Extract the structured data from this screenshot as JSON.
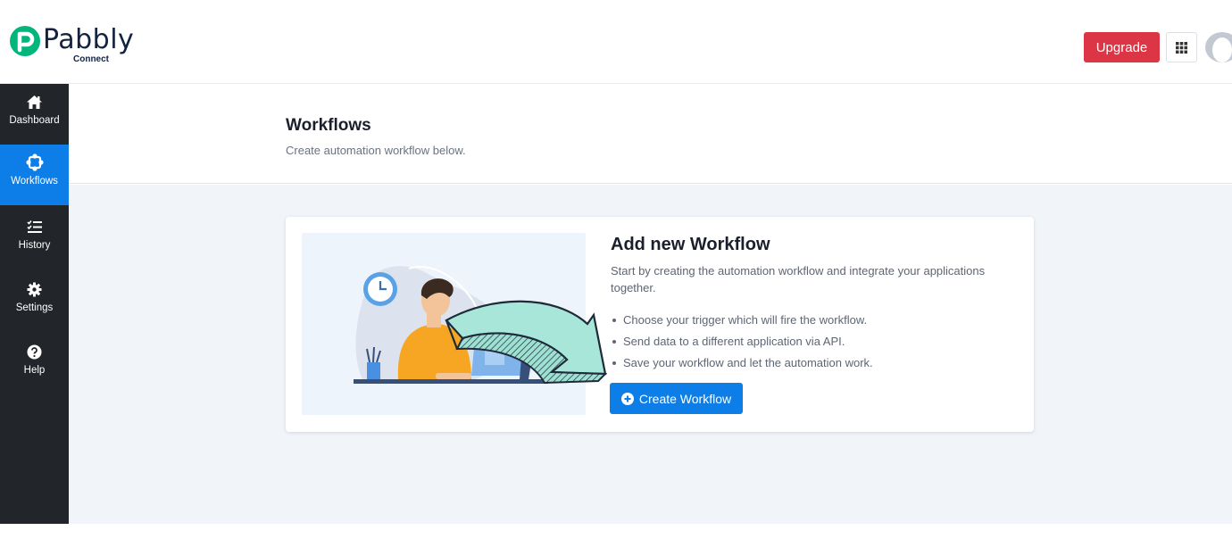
{
  "brand": {
    "name": "Pabbly",
    "product": "Connect",
    "color": "#13233f",
    "accent": "#00b67a"
  },
  "header": {
    "upgrade_label": "Upgrade",
    "upgrade_color": "#dc3545",
    "apps_icon": "grid-icon",
    "avatar_icon": "user-avatar-icon"
  },
  "sidebar": {
    "items": [
      {
        "label": "Dashboard",
        "icon": "home-icon",
        "active": false
      },
      {
        "label": "Workflows",
        "icon": "workflow-icon",
        "active": true
      },
      {
        "label": "History",
        "icon": "history-list-icon",
        "active": false
      },
      {
        "label": "Settings",
        "icon": "gear-icon",
        "active": false
      },
      {
        "label": "Help",
        "icon": "question-icon",
        "active": false
      }
    ],
    "bg_color": "#222529",
    "active_color": "#0d7de8"
  },
  "page": {
    "title": "Workflows",
    "subtitle": "Create automation workflow below."
  },
  "card": {
    "title": "Add new Workflow",
    "description": "Start by creating the automation workflow and integrate your applications together.",
    "bullets": [
      "Choose your trigger which will fire the workflow.",
      "Send data to a different application via API.",
      "Save your workflow and let the automation work."
    ],
    "button_label": "Create Workflow",
    "button_icon": "plus-circle-icon",
    "button_color": "#0d7de8"
  }
}
